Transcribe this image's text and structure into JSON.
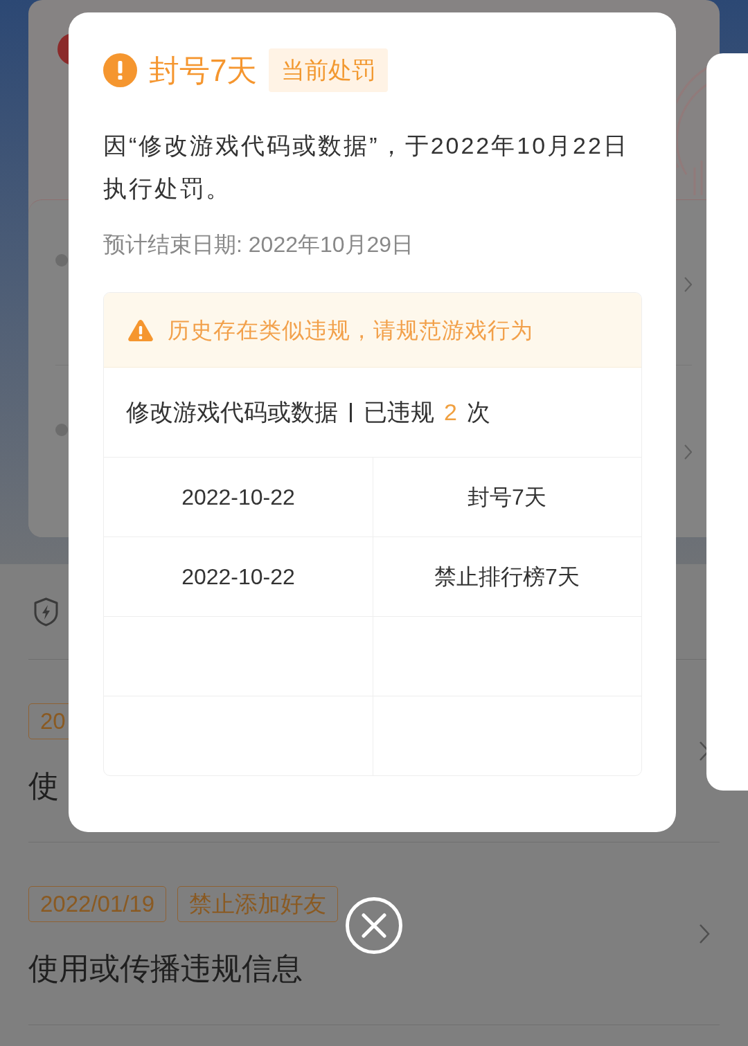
{
  "records": [
    {
      "tags": [
        {
          "label": "20"
        }
      ],
      "title": "使"
    },
    {
      "tags": [
        {
          "label": "2022/01/19"
        },
        {
          "label": "禁止添加好友"
        }
      ],
      "title": "使用或传播违规信息"
    }
  ],
  "dialog": {
    "title": "封号7天",
    "badge": "当前处罚",
    "message": "因“修改游戏代码或数据”，于2022年10月22日执行处罚。",
    "end_date": "预计结束日期: 2022年10月29日",
    "history": {
      "notice": "历史存在类似违规，请规范游戏行为",
      "violation": "修改游戏代码或数据",
      "count_label": "已违规",
      "count": "2",
      "count_unit": "次",
      "rows": [
        {
          "column_1": "2022-10-22",
          "column_2": "封号7天"
        },
        {
          "column_1": "2022-10-22",
          "column_2": "禁止排行榜7天"
        },
        {},
        {}
      ]
    }
  }
}
